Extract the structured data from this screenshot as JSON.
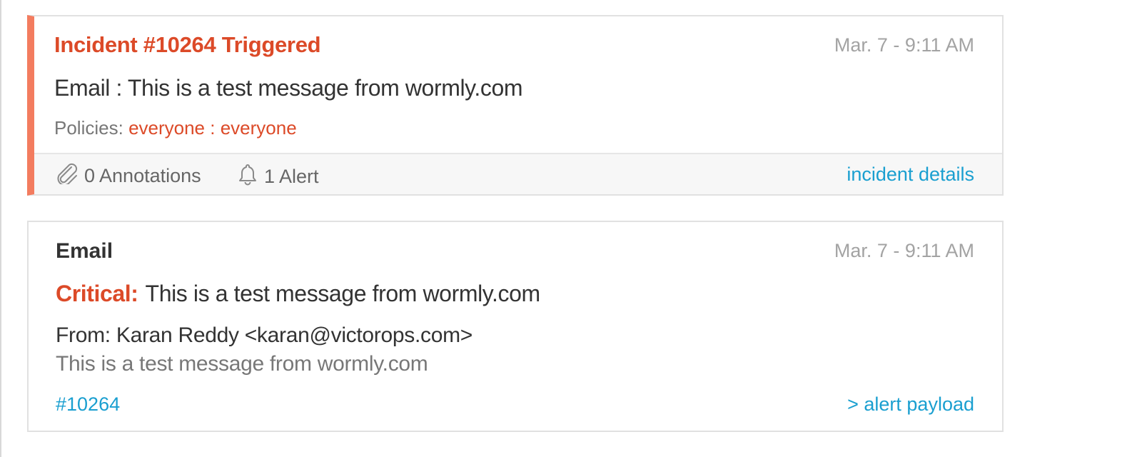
{
  "incident": {
    "title": "Incident #10264 Triggered",
    "timestamp": "Mar. 7 - 9:11 AM",
    "summary": "Email : This is a test message from wormly.com",
    "policies_label": "Policies:",
    "policies_value": "everyone : everyone",
    "annotations_label": "0 Annotations",
    "alerts_label": "1 Alert",
    "details_link": "incident details",
    "accent_color": "#f37c5f",
    "annotations_icon": "paperclip-icon",
    "alerts_icon": "bell-icon"
  },
  "alert": {
    "source": "Email",
    "timestamp": "Mar. 7 - 9:11 AM",
    "severity": "Critical:",
    "headline": "This is a test message from wormly.com",
    "from": "From: Karan Reddy <karan@victorops.com>",
    "body": "This is a test message from wormly.com",
    "incident_link": "#10264",
    "payload_link": "> alert payload",
    "link_color": "#1a9fd0",
    "severity_color": "#dc4a28"
  }
}
